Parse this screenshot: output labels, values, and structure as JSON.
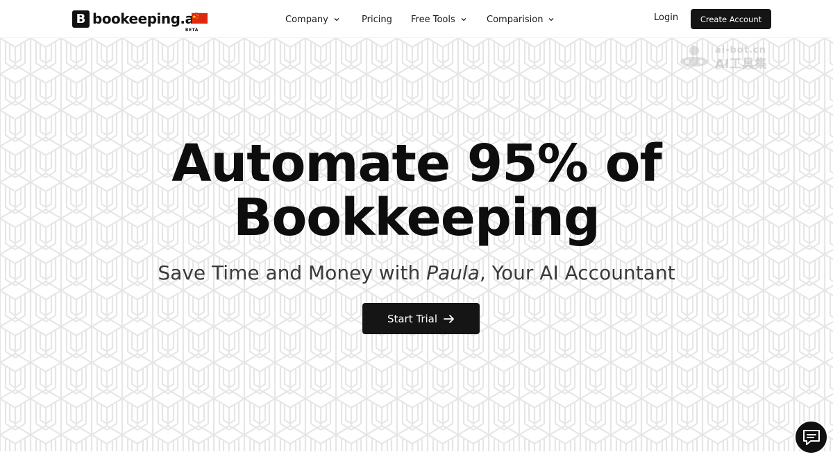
{
  "brand": {
    "name": "bookeeping.ai",
    "mark_letter": "B",
    "badge": "BETA",
    "region_flag": "china-flag"
  },
  "nav": {
    "items": [
      {
        "label": "Company",
        "has_dropdown": true
      },
      {
        "label": "Pricing",
        "has_dropdown": false
      },
      {
        "label": "Free Tools",
        "has_dropdown": true
      },
      {
        "label": "Comparision",
        "has_dropdown": true
      }
    ],
    "login_label": "Login",
    "create_account_label": "Create Account"
  },
  "hero": {
    "headline_line1": "Automate 95% of",
    "headline_line2": "Bookkeeping",
    "subtitle_before": "Save Time and Money with ",
    "subtitle_name": "Paula",
    "subtitle_after": ", Your AI Accountant",
    "cta_label": "Start Trial",
    "cta_icon": "arrow-right-icon"
  },
  "watermark": {
    "line1": "ai-bot.cn",
    "line2": "AI工具集"
  },
  "chat": {
    "icon": "chat-icon"
  },
  "colors": {
    "primary_button": "#151515",
    "text_dark": "#0d0d0d",
    "subtitle": "#3a3a3a",
    "pattern_line": "#e6e6e6",
    "background": "#ffffff"
  }
}
